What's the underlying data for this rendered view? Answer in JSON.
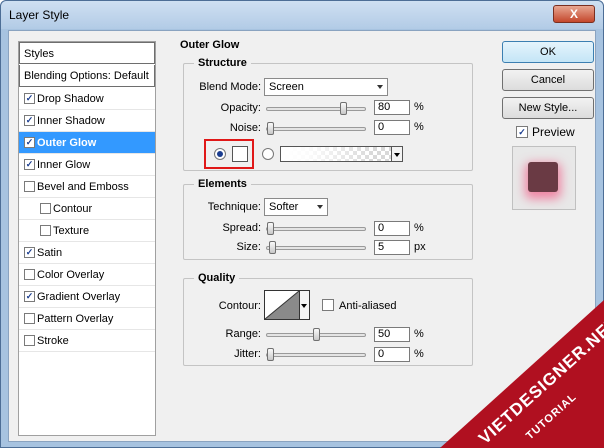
{
  "window": {
    "title": "Layer Style",
    "close_glyph": "X"
  },
  "styles_list": {
    "header": "Styles",
    "blending": "Blending Options: Default",
    "items": [
      {
        "label": "Drop Shadow",
        "checked": true,
        "sub": false,
        "selected": false
      },
      {
        "label": "Inner Shadow",
        "checked": true,
        "sub": false,
        "selected": false
      },
      {
        "label": "Outer Glow",
        "checked": true,
        "sub": false,
        "selected": true
      },
      {
        "label": "Inner Glow",
        "checked": true,
        "sub": false,
        "selected": false
      },
      {
        "label": "Bevel and Emboss",
        "checked": false,
        "sub": false,
        "selected": false
      },
      {
        "label": "Contour",
        "checked": false,
        "sub": true,
        "selected": false
      },
      {
        "label": "Texture",
        "checked": false,
        "sub": true,
        "selected": false
      },
      {
        "label": "Satin",
        "checked": true,
        "sub": false,
        "selected": false
      },
      {
        "label": "Color Overlay",
        "checked": false,
        "sub": false,
        "selected": false
      },
      {
        "label": "Gradient Overlay",
        "checked": true,
        "sub": false,
        "selected": false
      },
      {
        "label": "Pattern Overlay",
        "checked": false,
        "sub": false,
        "selected": false
      },
      {
        "label": "Stroke",
        "checked": false,
        "sub": false,
        "selected": false
      }
    ]
  },
  "outer_glow": {
    "title": "Outer Glow",
    "structure": {
      "title": "Structure",
      "blend_mode_label": "Blend Mode:",
      "blend_mode_value": "Screen",
      "opacity_label": "Opacity:",
      "opacity_value": "80",
      "opacity_level": 80,
      "opacity_unit": "%",
      "noise_label": "Noise:",
      "noise_value": "0",
      "noise_level": 0,
      "noise_unit": "%",
      "color_swatch": "#ffffff"
    },
    "elements": {
      "title": "Elements",
      "technique_label": "Technique:",
      "technique_value": "Softer",
      "spread_label": "Spread:",
      "spread_value": "0",
      "spread_level": 0,
      "spread_unit": "%",
      "size_label": "Size:",
      "size_value": "5",
      "size_level": 2,
      "size_unit": "px"
    },
    "quality": {
      "title": "Quality",
      "contour_label": "Contour:",
      "anti_aliased_label": "Anti-aliased",
      "anti_aliased": false,
      "range_label": "Range:",
      "range_value": "50",
      "range_level": 50,
      "range_unit": "%",
      "jitter_label": "Jitter:",
      "jitter_value": "0",
      "jitter_level": 0,
      "jitter_unit": "%"
    }
  },
  "buttons": {
    "ok": "OK",
    "cancel": "Cancel",
    "new_style": "New Style..."
  },
  "preview": {
    "label": "Preview",
    "checked": true
  },
  "watermark": {
    "site": "VIETDESIGNER.NET",
    "tag": "TUTORIAL"
  },
  "colors": {
    "selection": "#3399ff",
    "highlight_box": "#e01818",
    "watermark_band": "#b01020",
    "preview_glow": "#f0648c"
  }
}
